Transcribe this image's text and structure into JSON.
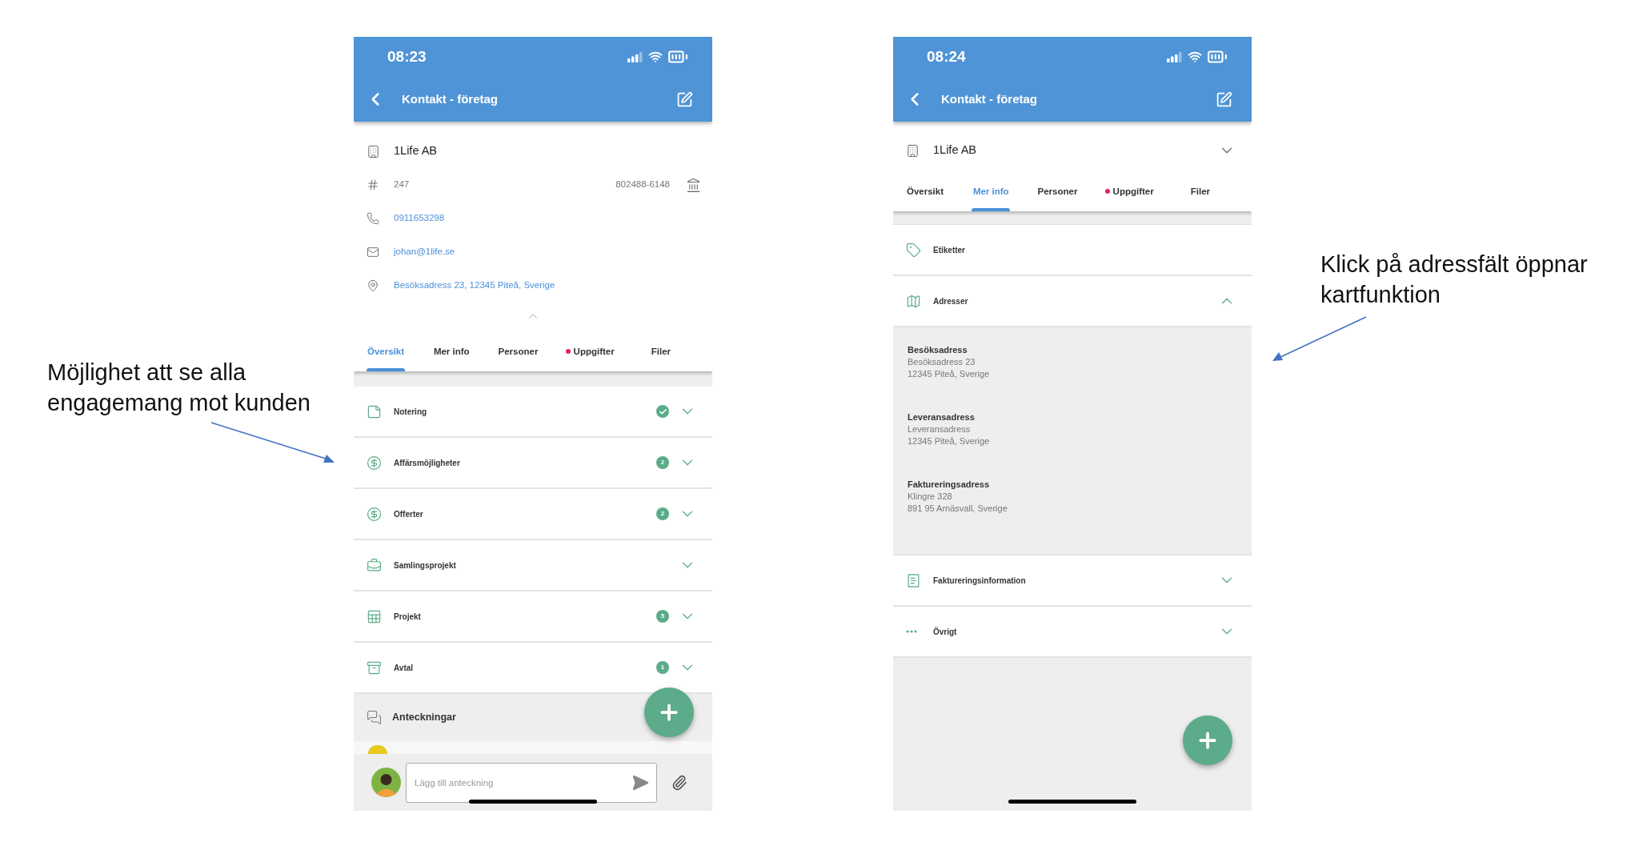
{
  "annotations": [
    {
      "text": "Möjlighet att se alla engagemang mot kunden"
    },
    {
      "text": "Klick på adressfält öppnar kartfunktion"
    }
  ],
  "left_screen": {
    "time": "08:23",
    "title": "Kontakt - företag",
    "company": "1Life AB",
    "details": [
      {
        "kind": "number",
        "text": "247",
        "extra": "802488-6148"
      },
      {
        "kind": "phone",
        "text": "0911653298"
      },
      {
        "kind": "email",
        "text": "johan@1life.se"
      },
      {
        "kind": "address",
        "text": "Besöksadress 23, 12345 Piteå, Sverige"
      }
    ],
    "tabs": [
      {
        "label": "Översikt",
        "selected": true,
        "dot": false
      },
      {
        "label": "Mer info",
        "selected": false,
        "dot": false
      },
      {
        "label": "Personer",
        "selected": false,
        "dot": false
      },
      {
        "label": "Uppgifter",
        "selected": false,
        "dot": true
      },
      {
        "label": "Filer",
        "selected": false,
        "dot": false
      }
    ],
    "sections": [
      {
        "label": "Notering",
        "done": true,
        "expanded": false
      },
      {
        "label": "Affärsmöjligheter",
        "count": "2",
        "expanded": false
      },
      {
        "label": "Offerter",
        "count": "2",
        "expanded": false
      },
      {
        "label": "Samlingsprojekt",
        "expanded": false
      },
      {
        "label": "Projekt",
        "count": "5",
        "expanded": false
      },
      {
        "label": "Avtal",
        "count": "1",
        "expanded": false
      }
    ],
    "notes_header": "Anteckningar",
    "note_input": {
      "placeholder": "Lägg till anteckning"
    }
  },
  "right_screen": {
    "time": "08:24",
    "title": "Kontakt - företag",
    "company": "1Life AB",
    "tabs": [
      {
        "label": "Översikt",
        "selected": false,
        "dot": false
      },
      {
        "label": "Mer info",
        "selected": true,
        "dot": false
      },
      {
        "label": "Personer",
        "selected": false,
        "dot": false
      },
      {
        "label": "Uppgifter",
        "selected": false,
        "dot": true
      },
      {
        "label": "Filer",
        "selected": false,
        "dot": false
      }
    ],
    "sections": [
      {
        "label": "Etiketter"
      },
      {
        "label": "Adresser",
        "expanded": true,
        "addresses": [
          {
            "label": "Besöksadress",
            "lines": [
              "Besöksadress 23",
              "12345 Piteå, Sverige"
            ]
          },
          {
            "label": "Leveransadress",
            "lines": [
              "Leveransadress",
              "12345 Piteå, Sverige"
            ]
          },
          {
            "label": "Faktureringsadress",
            "lines": [
              "Klingre 328",
              "891 95 Arnäsvall, Sverige"
            ]
          }
        ]
      },
      {
        "label": "Faktureringsinformation",
        "expanded": false
      },
      {
        "label": "Övrigt",
        "expanded": false
      }
    ]
  }
}
